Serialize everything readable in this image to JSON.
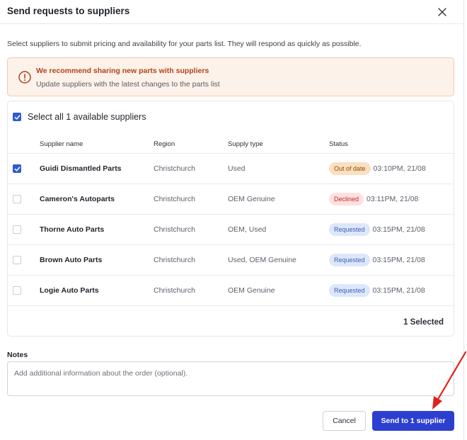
{
  "modal": {
    "title": "Send requests to suppliers",
    "intro": "Select suppliers to submit pricing and availability for your parts list. They will respond as quickly as possible."
  },
  "alert": {
    "title": "We recommend sharing new parts with suppliers",
    "text": "Update suppliers with the latest changes to the parts list",
    "icon": "info-circle-icon",
    "color": "#b3421a"
  },
  "table": {
    "select_all_label": "Select all 1 available suppliers",
    "select_all_checked": true,
    "headers": {
      "name": "Supplier name",
      "region": "Region",
      "supply": "Supply type",
      "status": "Status"
    },
    "rows": [
      {
        "name": "Guidi Dismantled Parts",
        "region": "Christchurch",
        "supply": "Used",
        "status": "Out of date",
        "time": "03:10PM, 21/08",
        "checked": true
      },
      {
        "name": "Cameron's Autoparts",
        "region": "Christchurch",
        "supply": "OEM Genuine",
        "status": "Declined",
        "time": "03:11PM, 21/08",
        "checked": false
      },
      {
        "name": "Thorne Auto Parts",
        "region": "Christchurch",
        "supply": "OEM, Used",
        "status": "Requested",
        "time": "03:15PM, 21/08",
        "checked": false
      },
      {
        "name": "Brown Auto Parts",
        "region": "Christchurch",
        "supply": "Used, OEM Genuine",
        "status": "Requested",
        "time": "03:15PM, 21/08",
        "checked": false
      },
      {
        "name": "Logie Auto Parts",
        "region": "Christchurch",
        "supply": "OEM Genuine",
        "status": "Requested",
        "time": "03:15PM, 21/08",
        "checked": false
      }
    ],
    "selected_count": "1 Selected"
  },
  "notes": {
    "label": "Notes",
    "placeholder": "Add additional information about the order (optional)."
  },
  "actions": {
    "cancel": "Cancel",
    "send": "Send to 1 supplier",
    "send_color": "#2c3fd1"
  },
  "annotation": {
    "arrow_color": "#e0221b"
  }
}
